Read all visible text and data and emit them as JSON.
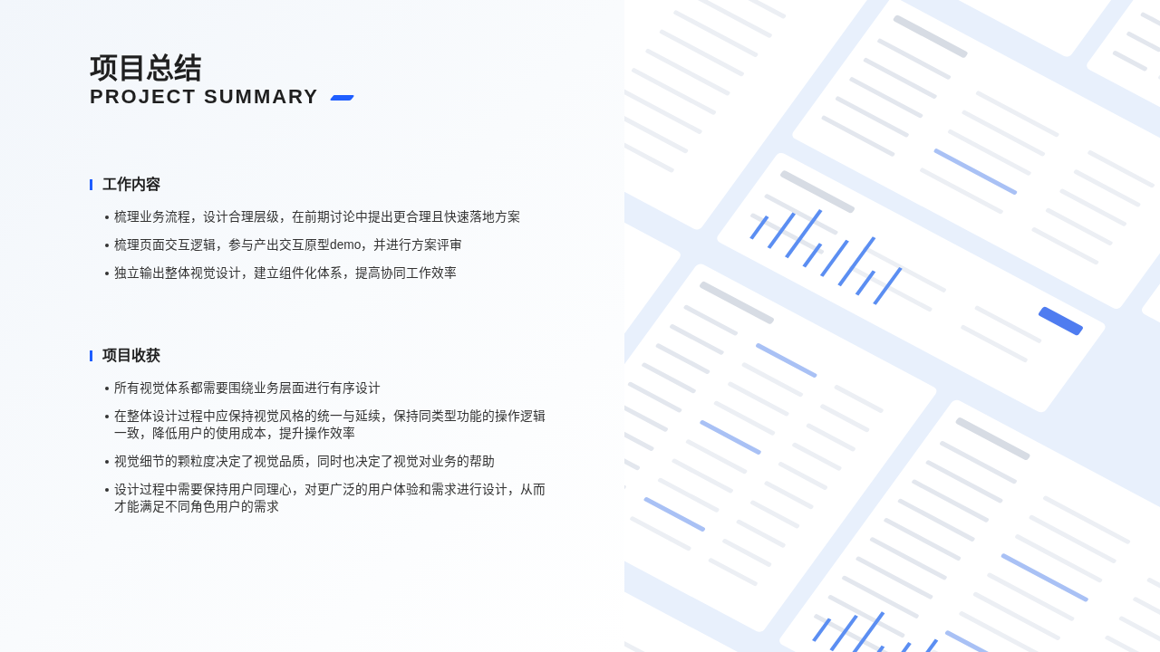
{
  "header": {
    "title": "项目总结",
    "subtitle": "PROJECT SUMMARY"
  },
  "sections": [
    {
      "heading": "工作内容",
      "items": [
        "梳理业务流程，设计合理层级，在前期讨论中提出更合理且快速落地方案",
        "梳理页面交互逻辑，参与产出交互原型demo，并进行方案评审",
        "独立输出整体视觉设计，建立组件化体系，提高协同工作效率"
      ]
    },
    {
      "heading": "项目收获",
      "items": [
        "所有视觉体系都需要围绕业务层面进行有序设计",
        "在整体设计过程中应保持视觉风格的统一与延续，保持同类型功能的操作逻辑一致，降低用户的使用成本，提升操作效率",
        "视觉细节的颗粒度决定了视觉品质，同时也决定了视觉对业务的帮助",
        "设计过程中需要保持用户同理心，对更广泛的用户体验和需求进行设计，从而才能满足不同角色用户的需求"
      ]
    }
  ]
}
